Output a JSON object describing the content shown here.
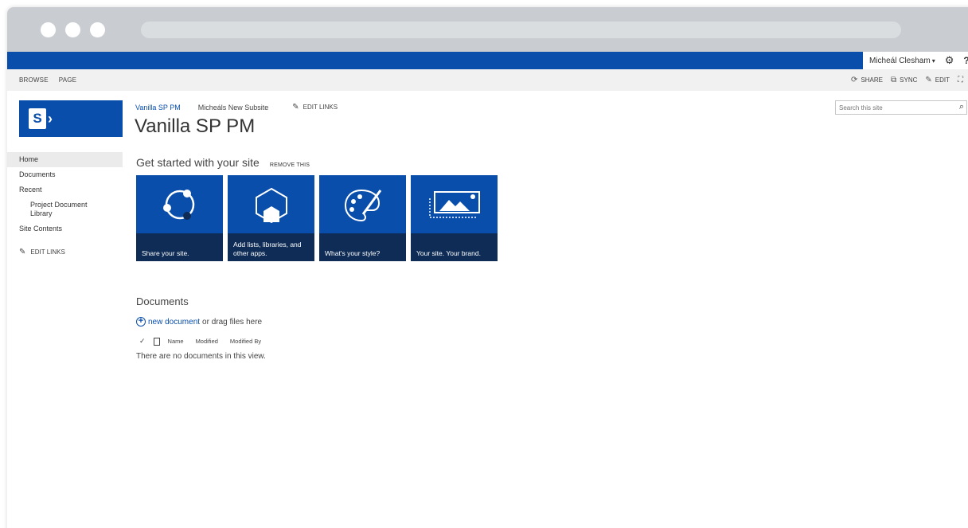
{
  "suitebar": {
    "user_name": "Micheál Clesham",
    "user_caret": "▾",
    "settings_icon": "gear-icon",
    "help_label": "?",
    "brand_color": "#0a4eab"
  },
  "ribbon": {
    "tabs": [
      "BROWSE",
      "PAGE"
    ],
    "actions": {
      "share": "SHARE",
      "sync": "SYNC",
      "edit": "EDIT"
    }
  },
  "header": {
    "breadcrumb_home": "Vanilla SP PM",
    "breadcrumb_subsite": "Micheáls New Subsite",
    "edit_links": "EDIT LINKS",
    "site_title": "Vanilla SP PM"
  },
  "search": {
    "placeholder": "Search this site"
  },
  "leftnav": {
    "items": [
      "Home",
      "Documents",
      "Recent",
      "Project Document Library",
      "Site Contents"
    ],
    "edit_links": "EDIT LINKS"
  },
  "get_started": {
    "title": "Get started with your site",
    "remove": "REMOVE THIS",
    "tiles": [
      {
        "caption": "Share your site.",
        "icon": "share-icon"
      },
      {
        "caption": "Add lists, libraries, and other apps.",
        "icon": "add-apps-icon"
      },
      {
        "caption": "What's your style?",
        "icon": "palette-icon"
      },
      {
        "caption": "Your site. Your brand.",
        "icon": "picture-icon"
      }
    ]
  },
  "documents": {
    "title": "Documents",
    "new_link": "new document",
    "new_rest": "or drag files here",
    "columns": [
      "Name",
      "Modified",
      "Modified By"
    ],
    "empty_message": "There are no documents in this view."
  }
}
